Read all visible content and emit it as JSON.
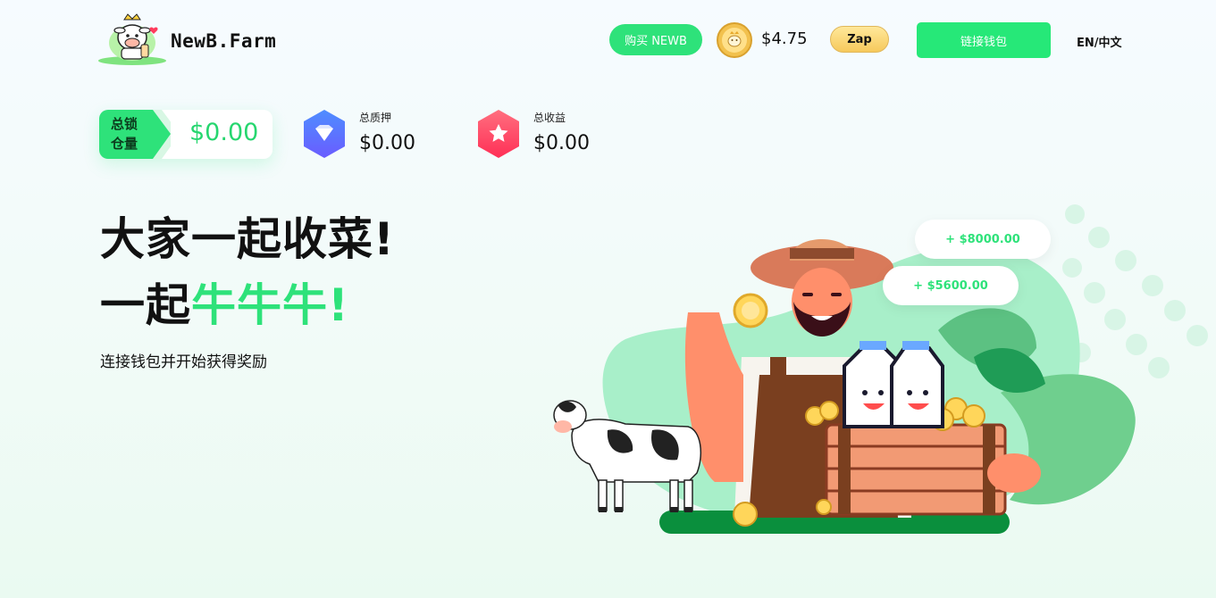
{
  "header": {
    "brand": "NewB.Farm",
    "buy_label": "购买 NEWB",
    "token_price": "$4.75",
    "zap_label": "Zap",
    "connect_wallet_label": "链接钱包",
    "lang_en": "EN",
    "lang_sep": "/",
    "lang_zh": "中文"
  },
  "stats": {
    "tvl_label": "总锁仓量",
    "tvl_value": "$0.00",
    "staked_label": "总质押",
    "staked_value": "$0.00",
    "earnings_label": "总收益",
    "earnings_value": "$0.00"
  },
  "hero": {
    "headline_line1": "大家一起收菜!",
    "headline_line2_prefix": "一起",
    "headline_line2_highlight": "牛牛牛!",
    "subtitle": "连接钱包并开始获得奖励",
    "badge_1": "+ $8000.00",
    "badge_2": "+ $5600.00"
  },
  "colors": {
    "accent_green": "#2ee27a",
    "wallet_green": "#26e878",
    "zap_gold": "#f6c95c",
    "staked_icon_blue": "#5b7cff",
    "earnings_icon_red": "#ff4d6a"
  },
  "icons": {
    "logo": "cow-mascot-logo",
    "token": "newb-coin-icon",
    "staked": "diamond-shield-icon",
    "earnings": "star-hexagon-icon"
  }
}
